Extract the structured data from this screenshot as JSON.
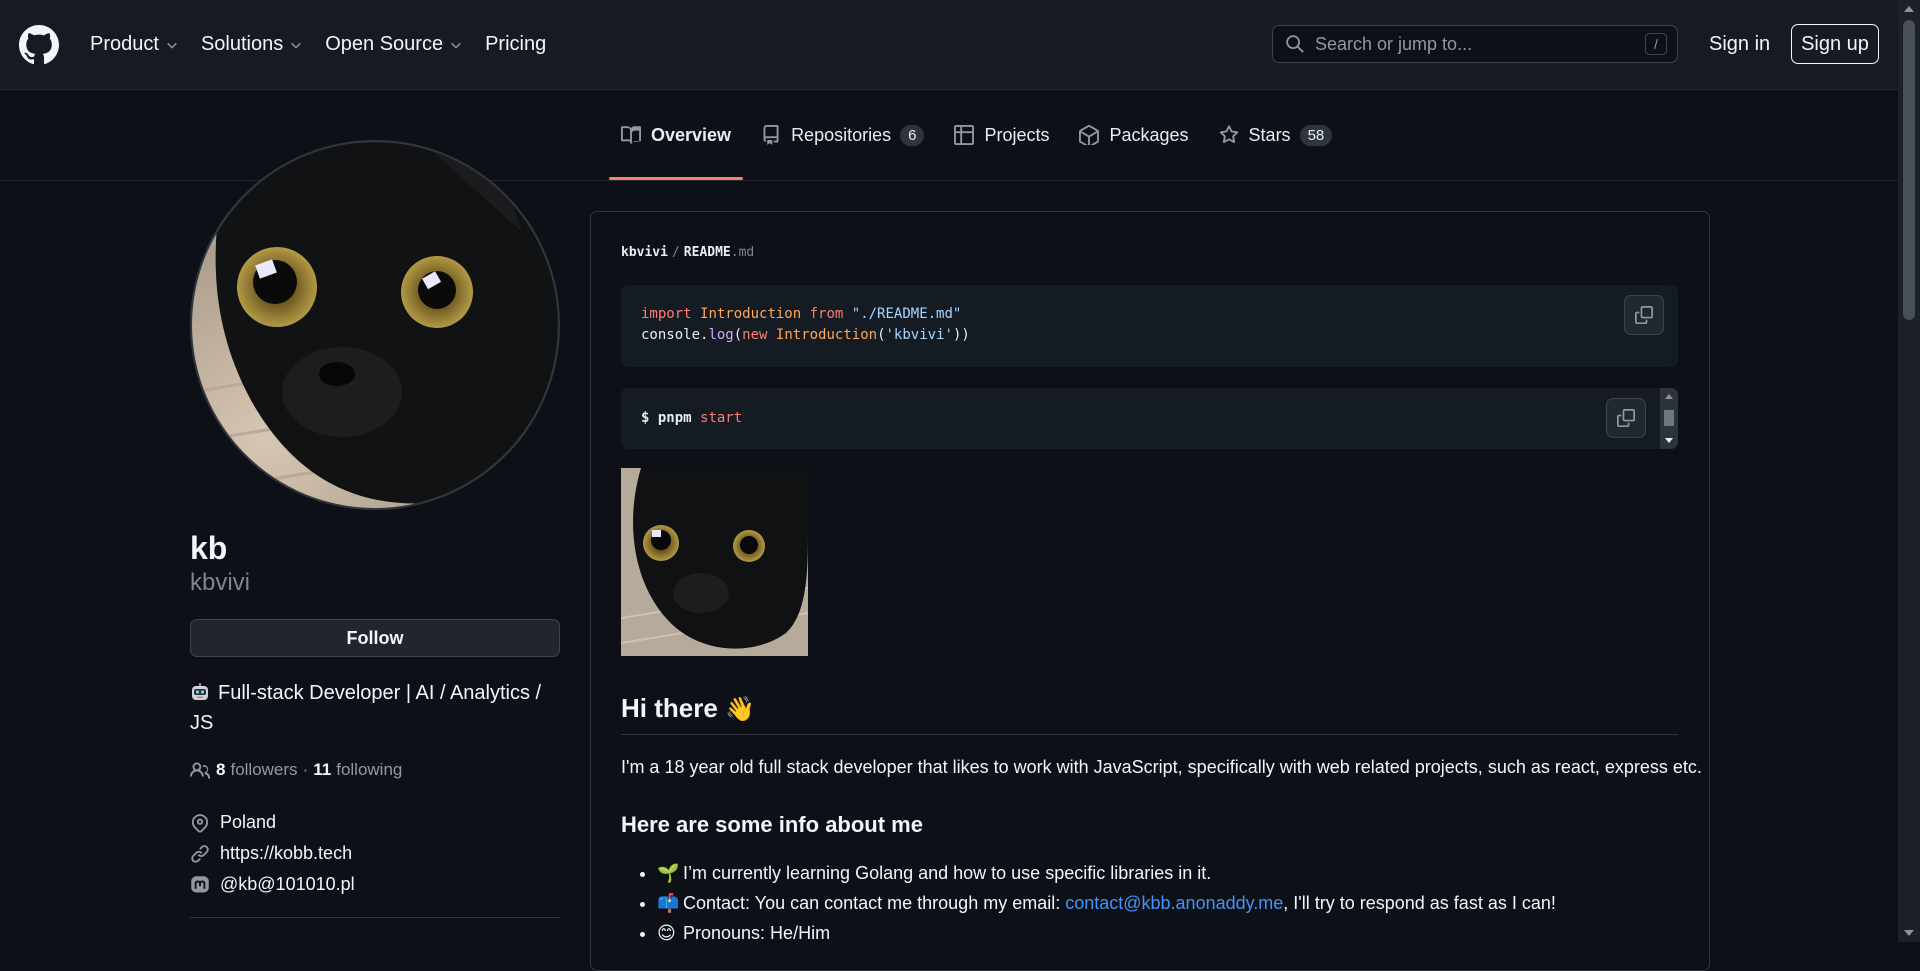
{
  "header": {
    "nav": [
      {
        "label": "Product",
        "has_menu": true
      },
      {
        "label": "Solutions",
        "has_menu": true
      },
      {
        "label": "Open Source",
        "has_menu": true
      },
      {
        "label": "Pricing",
        "has_menu": false
      }
    ],
    "search_placeholder": "Search or jump to...",
    "search_shortcut": "/",
    "sign_in": "Sign in",
    "sign_up": "Sign up"
  },
  "tabs": [
    {
      "label": "Overview",
      "icon": "book-icon",
      "active": true
    },
    {
      "label": "Repositories",
      "icon": "repo-icon",
      "count": "6"
    },
    {
      "label": "Projects",
      "icon": "table-icon"
    },
    {
      "label": "Packages",
      "icon": "package-icon"
    },
    {
      "label": "Stars",
      "icon": "star-icon",
      "count": "58"
    }
  ],
  "profile": {
    "name": "kb",
    "login": "kbvivi",
    "follow_label": "Follow",
    "bio_emoji": "robot-face",
    "bio": "Full-stack Developer | AI / Analytics / JS",
    "followers_count": "8",
    "followers_label": "followers",
    "separator": "·",
    "following_count": "11",
    "following_label": "following",
    "location": "Poland",
    "website": "https://kobb.tech",
    "mastodon": "@kb@101010.pl"
  },
  "readme": {
    "owner": "kbvivi",
    "file": "README",
    "ext": ".md",
    "code1": {
      "line1": {
        "kw1": "import",
        "cls": "Introduction",
        "kw2": "from",
        "str": "\"./README.md\""
      },
      "line2": {
        "obj": "console.",
        "fn": "log",
        "p1": "(",
        "kw": "new",
        "cls": "Introduction",
        "p2": "(",
        "str": "'kbvivi'",
        "p3": "))"
      }
    },
    "code2": {
      "prompt": "$ pnpm",
      "arg": "start"
    },
    "heading": "Hi there",
    "heading_emoji": "👋",
    "intro": "I'm a 18 year old full stack developer that likes to work with JavaScript, specifically with web related projects, such as react, express etc.",
    "subheading": "Here are some info about me",
    "items": [
      {
        "emoji": "🌱",
        "text": "I’m currently learning Golang and how to use specific libraries in it."
      },
      {
        "emoji": "📫",
        "text_before": "Contact: You can contact me through my email: ",
        "link": "contact@kbb.anonaddy.me",
        "text_after": ", I'll try to respond as fast as I can!"
      },
      {
        "emoji": "😊",
        "text": "Pronouns: He/Him"
      }
    ]
  },
  "colors": {
    "background": "#0d1117",
    "header": "#161b22",
    "accent_underline": "#f78166",
    "link": "#4493f8"
  }
}
